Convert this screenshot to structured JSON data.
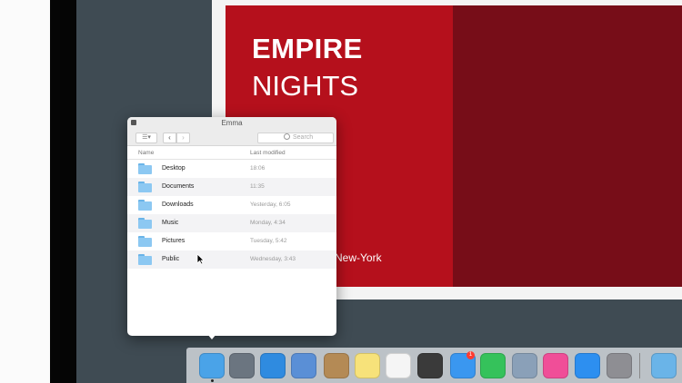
{
  "poster": {
    "title_line1": "EMPIRE",
    "title_line2": "NIGHTS",
    "city": "New-York"
  },
  "finder": {
    "window_title": "Emma",
    "search_placeholder": "Search",
    "columns": {
      "name": "Name",
      "modified": "Last modified"
    },
    "rows": [
      {
        "name": "Desktop",
        "modified": "18:06"
      },
      {
        "name": "Documents",
        "modified": "11:35"
      },
      {
        "name": "Downloads",
        "modified": "Yesterday, 6:05"
      },
      {
        "name": "Music",
        "modified": "Monday, 4:34"
      },
      {
        "name": "Pictures",
        "modified": "Tuesday, 5:42"
      },
      {
        "name": "Public",
        "modified": "Wednesday, 3:43"
      }
    ]
  },
  "dock": {
    "items": [
      {
        "name": "finder-icon",
        "color": "#4aa3e8"
      },
      {
        "name": "launchpad-icon",
        "color": "#6b7580"
      },
      {
        "name": "safari-icon",
        "color": "#2f8be0"
      },
      {
        "name": "mail-icon",
        "color": "#5a8fd6"
      },
      {
        "name": "contacts-icon",
        "color": "#b48a55"
      },
      {
        "name": "notes-icon",
        "color": "#f7e27a"
      },
      {
        "name": "reminders-icon",
        "color": "#f5f5f5"
      },
      {
        "name": "siri-icon",
        "color": "#3a3a3a"
      },
      {
        "name": "messages-icon",
        "color": "#3a97f0"
      },
      {
        "name": "facetime-icon",
        "color": "#35c25b"
      },
      {
        "name": "preview-icon",
        "color": "#8aa0b8"
      },
      {
        "name": "itunes-icon",
        "color": "#f04e98"
      },
      {
        "name": "app-store-icon",
        "color": "#2d8ff0"
      },
      {
        "name": "system-preferences-icon",
        "color": "#8e8e93"
      },
      {
        "name": "downloads-folder-icon",
        "color": "#6ab4e8"
      }
    ],
    "messages_badge": "1"
  }
}
